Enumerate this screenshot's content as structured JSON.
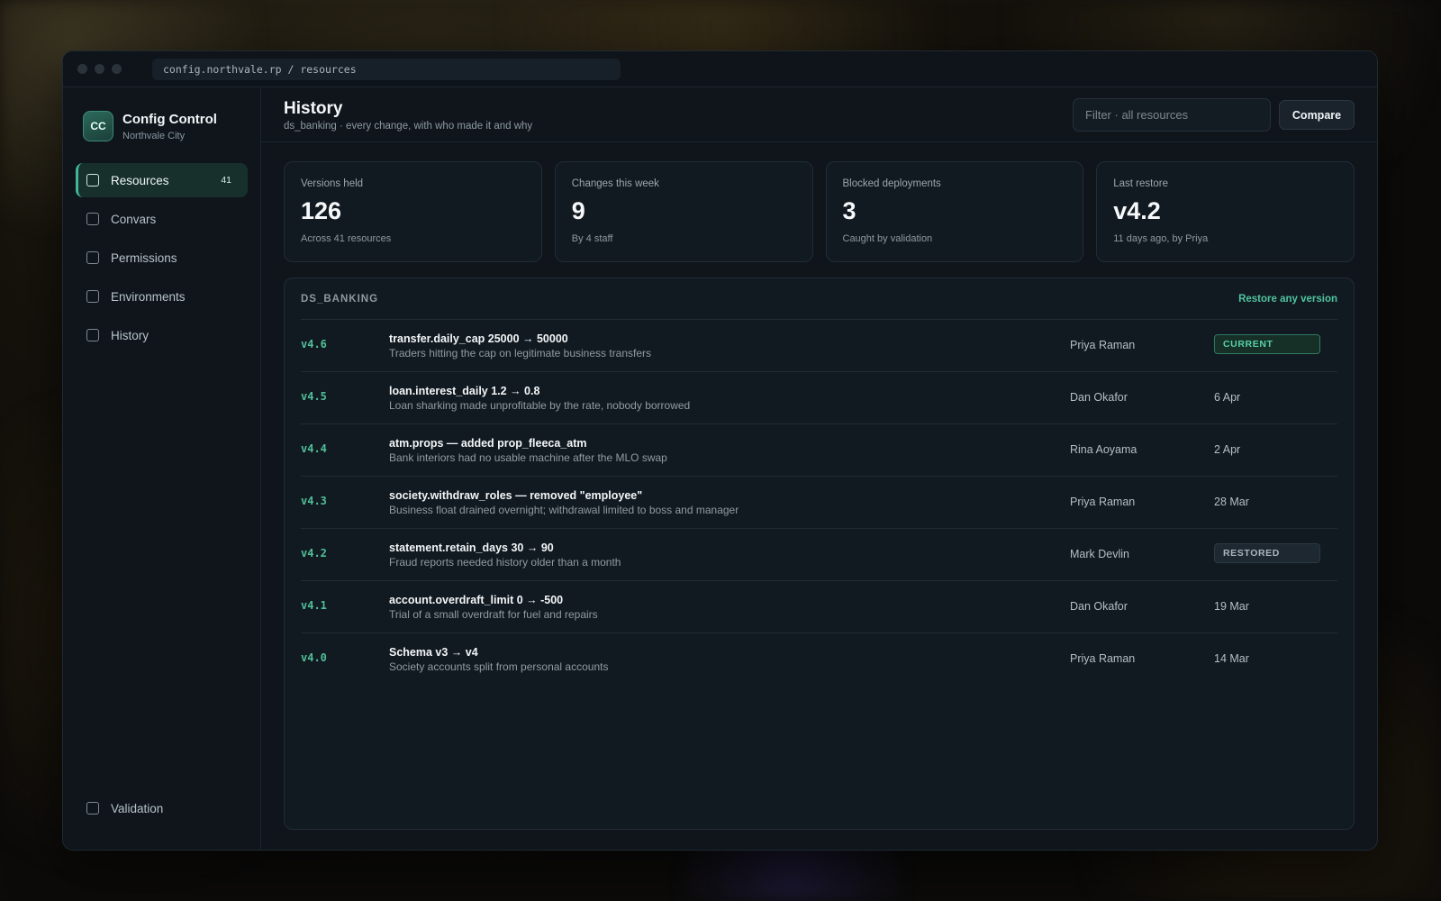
{
  "url": "config.northvale.rp / resources",
  "brand": {
    "logo": "CC",
    "title": "Config Control",
    "subtitle": "Northvale City"
  },
  "nav": {
    "items": [
      {
        "label": "Resources",
        "count": "41",
        "active": true
      },
      {
        "label": "Convars"
      },
      {
        "label": "Permissions"
      },
      {
        "label": "Environments"
      },
      {
        "label": "History"
      }
    ],
    "bottom": {
      "label": "Validation"
    }
  },
  "header": {
    "title": "History",
    "subtitle": "ds_banking · every change, with who made it and why",
    "filter_placeholder": "Filter · all resources",
    "compare_label": "Compare"
  },
  "stats": [
    {
      "label": "Versions held",
      "value": "126",
      "note": "Across 41 resources"
    },
    {
      "label": "Changes this week",
      "value": "9",
      "note": "By 4 staff"
    },
    {
      "label": "Blocked deployments",
      "value": "3",
      "note": "Caught by validation"
    },
    {
      "label": "Last restore",
      "value": "v4.2",
      "note": "11 days ago, by Priya"
    }
  ],
  "panel": {
    "title": "DS_BANKING",
    "restore_link": "Restore any version",
    "rows": [
      {
        "version": "v4.6",
        "title": "transfer.daily_cap 25000 → 50000",
        "desc": "Traders hitting the cap on legitimate business transfers",
        "author": "Priya Raman",
        "badge": "CURRENT",
        "badge_type": "current"
      },
      {
        "version": "v4.5",
        "title": "loan.interest_daily 1.2 → 0.8",
        "desc": "Loan sharking made unprofitable by the rate, nobody borrowed",
        "author": "Dan Okafor",
        "date": "6 Apr"
      },
      {
        "version": "v4.4",
        "title": "atm.props — added prop_fleeca_atm",
        "desc": "Bank interiors had no usable machine after the MLO swap",
        "author": "Rina Aoyama",
        "date": "2 Apr"
      },
      {
        "version": "v4.3",
        "title": "society.withdraw_roles — removed \"employee\"",
        "desc": "Business float drained overnight; withdrawal limited to boss and manager",
        "author": "Priya Raman",
        "date": "28 Mar"
      },
      {
        "version": "v4.2",
        "title": "statement.retain_days 30 → 90",
        "desc": "Fraud reports needed history older than a month",
        "author": "Mark Devlin",
        "badge": "RESTORED",
        "badge_type": "restored"
      },
      {
        "version": "v4.1",
        "title": "account.overdraft_limit 0 → -500",
        "desc": "Trial of a small overdraft for fuel and repairs",
        "author": "Dan Okafor",
        "date": "19 Mar"
      },
      {
        "version": "v4.0",
        "title": "Schema v3 → v4",
        "desc": "Society accounts split from personal accounts",
        "author": "Priya Raman",
        "date": "14 Mar"
      }
    ]
  },
  "colors": {
    "accent": "#4fbf98",
    "background": "#0f151b",
    "panel": "#121a21"
  }
}
